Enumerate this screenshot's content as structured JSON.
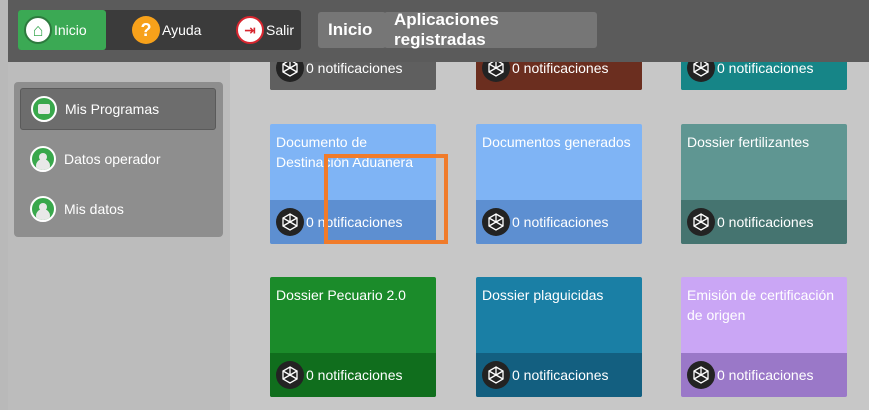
{
  "topbar": {
    "home_label": "Inicio",
    "help_label": "Ayuda",
    "exit_label": "Salir",
    "help_glyph": "?",
    "breadcrumbs": [
      "Inicio",
      "Aplicaciones registradas"
    ]
  },
  "sidebar": {
    "items": [
      {
        "label": "Mis Programas",
        "icon": "programs-icon",
        "active": true
      },
      {
        "label": "Datos operador",
        "icon": "user-icon",
        "active": false
      },
      {
        "label": "Mis datos",
        "icon": "user-icon",
        "active": false
      }
    ]
  },
  "tiles": [
    {
      "title": "",
      "notif": "0 notificaciones",
      "color": "#5f5f5f",
      "foot": "#5f5f5f"
    },
    {
      "title": "",
      "notif": "0 notificaciones",
      "color": "#6b2e1f",
      "foot": "#6b2e1f"
    },
    {
      "title": "",
      "notif": "0 notificaciones",
      "color": "#168587",
      "foot": "#168587"
    },
    {
      "title": "Documento de Destinación Aduanera",
      "notif": "0 notificaciones",
      "color": "#7fb4f5",
      "foot": "#5d8fd1"
    },
    {
      "title": "Documentos generados",
      "notif": "0 notificaciones",
      "color": "#7fb4f5",
      "foot": "#5d8fd1"
    },
    {
      "title": "Dossier fertilizantes",
      "notif": "0 notificaciones",
      "color": "#5f9692",
      "foot": "#457470"
    },
    {
      "title": "Dossier Pecuario 2.0",
      "notif": "0 notificaciones",
      "color": "#1b8b2a",
      "foot": "#106e1d"
    },
    {
      "title": "Dossier plaguicidas",
      "notif": "0 notificaciones",
      "color": "#1a7fa5",
      "foot": "#135f80"
    },
    {
      "title": "Emisión de certificación de origen",
      "notif": "0 notificaciones",
      "color": "#caa6f5",
      "foot": "#9a78c8"
    }
  ]
}
